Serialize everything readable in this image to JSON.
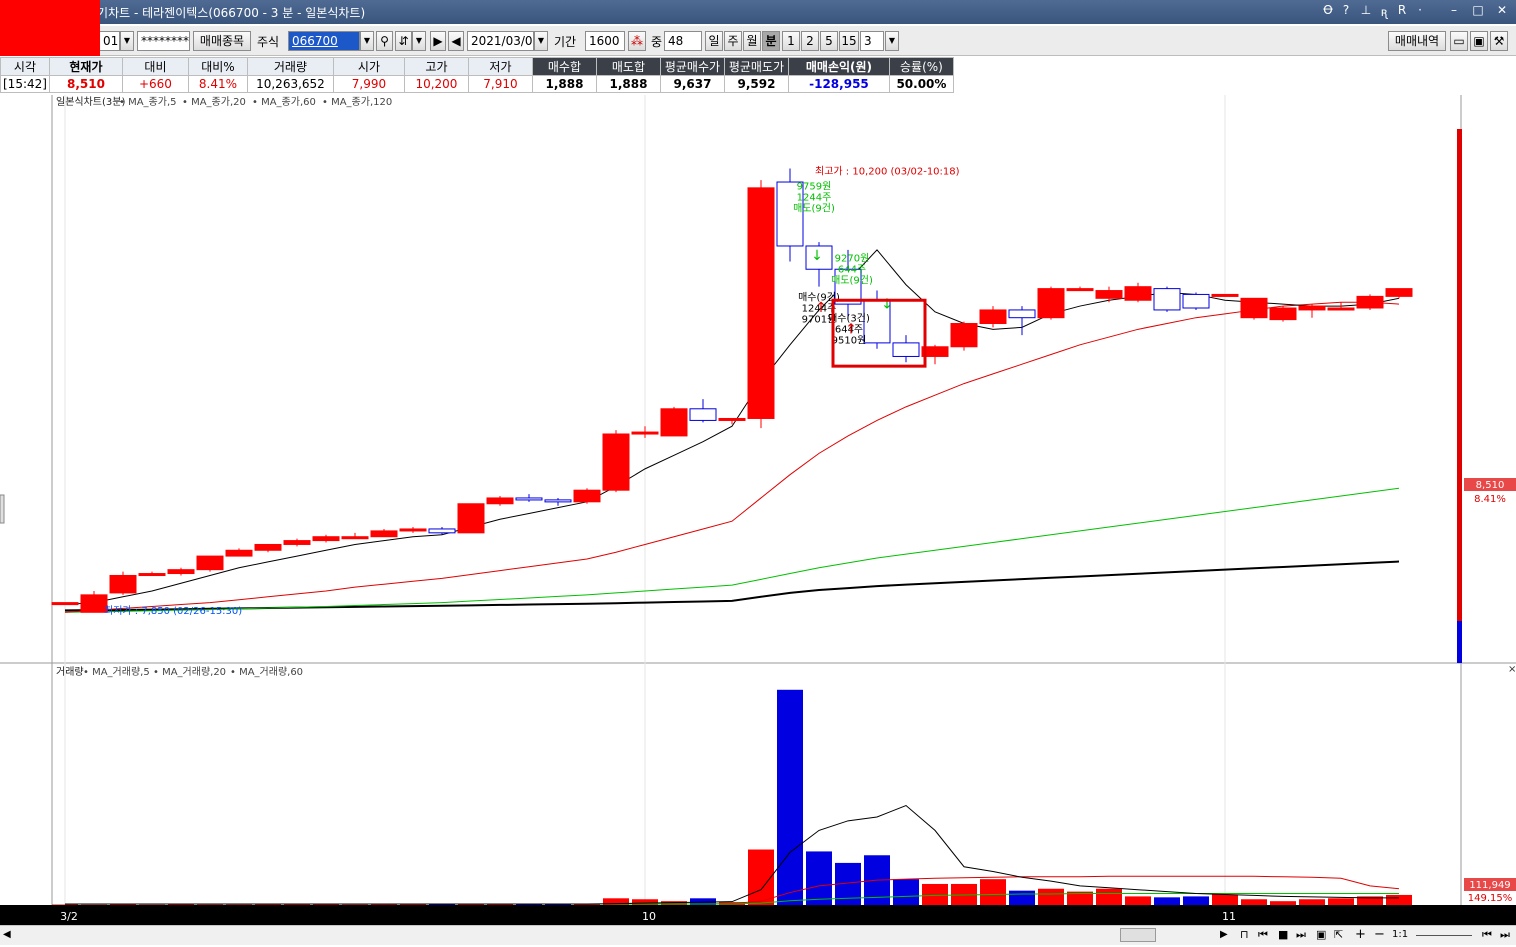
{
  "window": {
    "title": "[2450]매매복기차트 - 테라젠이텍스(066700 - 3 분 - 일본식차트)",
    "controls": [
      "Ꝋ",
      "?",
      "⊥",
      "ꭆ",
      "R",
      "·",
      "–",
      "□",
      "✕"
    ]
  },
  "toolbar": {
    "account_suffix": "01",
    "password": "********",
    "trade_items_button": "매매종목",
    "market_type": "주식",
    "stock_code": "066700",
    "date": "2021/03/02",
    "period_label": "기간",
    "period_value": "1600",
    "mid_label": "중",
    "count_value": "48",
    "period_buttons": [
      "일",
      "주",
      "월",
      "분"
    ],
    "selected_period": "분",
    "minute_buttons": [
      "1",
      "2",
      "5",
      "15"
    ],
    "minute_value": "3",
    "trade_history_button": "매매내역"
  },
  "info": {
    "headers": [
      "시각",
      "현재가",
      "대비",
      "대비%",
      "거래량",
      "시가",
      "고가",
      "저가",
      "매수합",
      "매도합",
      "평균매수가",
      "평균매도가",
      "매매손익(원)",
      "승률(%)"
    ],
    "values": [
      "[15:42]",
      "8,510",
      "+660",
      "8.41%",
      "10,263,652",
      "7,990",
      "10,200",
      "7,910",
      "1,888",
      "1,888",
      "9,637",
      "9,592",
      "-128,955",
      "50.00%"
    ]
  },
  "chart_data": [
    {
      "type": "candlestick",
      "title": "일본식차트(3분)",
      "legend": [
        {
          "name": "MA_종가,5",
          "color": "#e00000"
        },
        {
          "name": "MA_종가,20",
          "color": "#000000"
        },
        {
          "name": "MA_종가,60",
          "color": "#e00000"
        },
        {
          "name": "MA_종가,120",
          "color": "#00c000"
        }
      ],
      "ylim": [
        7700,
        10450
      ],
      "x_ticks": [
        {
          "index": 0,
          "label": "3/2"
        },
        {
          "index": 20,
          "label": "10"
        },
        {
          "index": 40,
          "label": "11"
        }
      ],
      "candles": [
        {
          "o": 7960,
          "c": 7960,
          "h": 7960,
          "l": 7960
        },
        {
          "o": 7910,
          "c": 8000,
          "h": 8020,
          "l": 7910
        },
        {
          "o": 8010,
          "c": 8100,
          "h": 8120,
          "l": 8000
        },
        {
          "o": 8100,
          "c": 8110,
          "h": 8120,
          "l": 8100
        },
        {
          "o": 8110,
          "c": 8130,
          "h": 8140,
          "l": 8100
        },
        {
          "o": 8130,
          "c": 8200,
          "h": 8200,
          "l": 8120
        },
        {
          "o": 8200,
          "c": 8230,
          "h": 8240,
          "l": 8200
        },
        {
          "o": 8230,
          "c": 8260,
          "h": 8260,
          "l": 8220
        },
        {
          "o": 8260,
          "c": 8280,
          "h": 8290,
          "l": 8250
        },
        {
          "o": 8280,
          "c": 8300,
          "h": 8310,
          "l": 8270
        },
        {
          "o": 8300,
          "c": 8300,
          "h": 8320,
          "l": 8290
        },
        {
          "o": 8300,
          "c": 8330,
          "h": 8340,
          "l": 8300
        },
        {
          "o": 8330,
          "c": 8340,
          "h": 8350,
          "l": 8320
        },
        {
          "o": 8340,
          "c": 8320,
          "h": 8350,
          "l": 8310
        },
        {
          "o": 8320,
          "c": 8470,
          "h": 8470,
          "l": 8320
        },
        {
          "o": 8470,
          "c": 8500,
          "h": 8510,
          "l": 8460
        },
        {
          "o": 8500,
          "c": 8490,
          "h": 8520,
          "l": 8480
        },
        {
          "o": 8490,
          "c": 8480,
          "h": 8500,
          "l": 8460
        },
        {
          "o": 8480,
          "c": 8540,
          "h": 8550,
          "l": 8470
        },
        {
          "o": 8540,
          "c": 8830,
          "h": 8850,
          "l": 8530
        },
        {
          "o": 8830,
          "c": 8840,
          "h": 8870,
          "l": 8810
        },
        {
          "o": 8820,
          "c": 8960,
          "h": 8970,
          "l": 8820
        },
        {
          "o": 8960,
          "c": 8900,
          "h": 9010,
          "l": 8890
        },
        {
          "o": 8900,
          "c": 8910,
          "h": 8910,
          "l": 8880
        },
        {
          "o": 8910,
          "c": 10100,
          "h": 10140,
          "l": 8860
        },
        {
          "o": 10130,
          "c": 9800,
          "h": 10200,
          "l": 9720
        },
        {
          "o": 9800,
          "c": 9680,
          "h": 9820,
          "l": 9590
        },
        {
          "o": 9680,
          "c": 9500,
          "h": 9780,
          "l": 9420
        },
        {
          "o": 9520,
          "c": 9300,
          "h": 9570,
          "l": 9270
        },
        {
          "o": 9300,
          "c": 9230,
          "h": 9340,
          "l": 9200
        },
        {
          "o": 9230,
          "c": 9280,
          "h": 9290,
          "l": 9190
        },
        {
          "o": 9280,
          "c": 9400,
          "h": 9410,
          "l": 9260
        },
        {
          "o": 9400,
          "c": 9470,
          "h": 9490,
          "l": 9380
        },
        {
          "o": 9470,
          "c": 9430,
          "h": 9490,
          "l": 9340
        },
        {
          "o": 9430,
          "c": 9580,
          "h": 9590,
          "l": 9420
        },
        {
          "o": 9580,
          "c": 9580,
          "h": 9590,
          "l": 9570
        },
        {
          "o": 9530,
          "c": 9570,
          "h": 9590,
          "l": 9510
        },
        {
          "o": 9520,
          "c": 9590,
          "h": 9610,
          "l": 9510
        },
        {
          "o": 9580,
          "c": 9470,
          "h": 9590,
          "l": 9460
        },
        {
          "o": 9550,
          "c": 9480,
          "h": 9560,
          "l": 9470
        },
        {
          "o": 9540,
          "c": 9550,
          "h": 9550,
          "l": 9540
        },
        {
          "o": 9430,
          "c": 9530,
          "h": 9530,
          "l": 9420
        },
        {
          "o": 9420,
          "c": 9480,
          "h": 9490,
          "l": 9410
        },
        {
          "o": 9470,
          "c": 9490,
          "h": 9500,
          "l": 9430
        },
        {
          "o": 9480,
          "c": 9480,
          "h": 9510,
          "l": 9470
        },
        {
          "o": 9480,
          "c": 9540,
          "h": 9550,
          "l": 9470
        },
        {
          "o": 9540,
          "c": 9580,
          "h": 9580,
          "l": 9530
        }
      ],
      "ma5": [
        7950,
        7960,
        7990,
        8020,
        8060,
        8100,
        8140,
        8170,
        8200,
        8230,
        8260,
        8280,
        8300,
        8310,
        8350,
        8390,
        8420,
        8450,
        8480,
        8560,
        8650,
        8720,
        8790,
        8870,
        9100,
        9290,
        9470,
        9620,
        9780,
        9600,
        9460,
        9400,
        9370,
        9380,
        9450,
        9490,
        9520,
        9540,
        9560,
        9550,
        9520,
        9510,
        9500,
        9490,
        9490,
        9500,
        9530
      ],
      "ma20": [
        7910,
        7920,
        7930,
        7940,
        7950,
        7960,
        7975,
        7990,
        8005,
        8020,
        8040,
        8055,
        8070,
        8085,
        8105,
        8125,
        8145,
        8165,
        8185,
        8220,
        8260,
        8300,
        8340,
        8380,
        8500,
        8620,
        8730,
        8820,
        8900,
        8970,
        9030,
        9090,
        9140,
        9190,
        9240,
        9290,
        9330,
        9370,
        9400,
        9430,
        9450,
        9470,
        9490,
        9500,
        9510,
        9510,
        9500
      ],
      "ma60": [
        7910,
        7912,
        7915,
        7918,
        7921,
        7924,
        7928,
        7932,
        7936,
        7940,
        7945,
        7950,
        7955,
        7960,
        7968,
        7976,
        7984,
        7992,
        8000,
        8010,
        8020,
        8030,
        8040,
        8050,
        8080,
        8110,
        8140,
        8165,
        8190,
        8210,
        8230,
        8250,
        8270,
        8290,
        8310,
        8330,
        8350,
        8370,
        8390,
        8410,
        8430,
        8450,
        8470,
        8490,
        8510,
        8530,
        8550
      ],
      "ma120": [
        7920,
        7921,
        7922,
        7924,
        7926,
        7928,
        7930,
        7932,
        7934,
        7936,
        7938,
        7940,
        7942,
        7944,
        7946,
        7948,
        7950,
        7952,
        7954,
        7957,
        7960,
        7963,
        7966,
        7969,
        7990,
        8010,
        8025,
        8035,
        8045,
        8053,
        8060,
        8067,
        8074,
        8081,
        8088,
        8095,
        8102,
        8109,
        8116,
        8123,
        8130,
        8137,
        8144,
        8151,
        8158,
        8165,
        8172
      ],
      "annotations": {
        "high": "최고가 : 10,200 (03/02-10:18)",
        "low": "최저가 : 7,850 (02/26-15:30)",
        "sell1": [
          "9759원",
          "1244주",
          "매도(9건)"
        ],
        "sell2": [
          "9270원",
          "644주",
          "매도(9건)"
        ],
        "buy1": [
          "매수(9건)",
          "1244주",
          "9701원"
        ],
        "buy2": [
          "매수(3건)",
          "644주",
          "9510원"
        ]
      },
      "price_label": "8,510",
      "change_label": "8.41%"
    },
    {
      "type": "bar",
      "title": "거래량",
      "legend": [
        {
          "name": "MA_거래량,5",
          "color": "#e00000"
        },
        {
          "name": "MA_거래량,20",
          "color": "#000000"
        },
        {
          "name": "MA_거래량,60",
          "color": "#e00000"
        }
      ],
      "ylim": [
        0,
        230000
      ],
      "volumes": [
        500,
        300,
        600,
        300,
        800,
        400,
        400,
        500,
        500,
        600,
        400,
        500,
        500,
        600,
        1200,
        900,
        1000,
        1200,
        1500,
        7000,
        6000,
        4000,
        7000,
        3000,
        58000,
        225000,
        56000,
        44000,
        52000,
        27000,
        22000,
        22000,
        27000,
        15000,
        17000,
        14000,
        17000,
        9000,
        8000,
        9000,
        11000,
        6000,
        4000,
        6000,
        7000,
        9000,
        10500
      ],
      "vol_ma5": [
        1000,
        1000,
        1000,
        1000,
        1000,
        1000,
        1000,
        1000,
        1000,
        1000,
        1000,
        1000,
        1000,
        1000,
        1000,
        1000,
        1000,
        1000,
        1000,
        1500,
        2000,
        2500,
        3000,
        3500,
        16000,
        55000,
        78000,
        88000,
        92000,
        104000,
        78000,
        40000,
        35000,
        29000,
        25000,
        20000,
        18000,
        16000,
        14000,
        12000,
        11000,
        10000,
        9000,
        8500,
        8000,
        7500,
        7500
      ],
      "vol_ma20": [
        1000,
        1000,
        1000,
        1000,
        1000,
        1000,
        1000,
        1000,
        1000,
        1000,
        1000,
        1000,
        1000,
        1000,
        1000,
        1000,
        1000,
        1000,
        1000,
        1000,
        1000,
        1000,
        1000,
        1500,
        4000,
        13000,
        20000,
        23000,
        26000,
        27000,
        28000,
        28500,
        29000,
        29500,
        29500,
        29500,
        30000,
        30000,
        30000,
        30000,
        30000,
        30000,
        29500,
        29000,
        28000,
        20000,
        17000
      ],
      "vol_ma60": [
        1000,
        1000,
        1000,
        1000,
        1000,
        1000,
        1000,
        1000,
        1000,
        1000,
        1000,
        1000,
        1000,
        1000,
        1000,
        1000,
        1000,
        1000,
        1000,
        1000,
        1000,
        1000,
        1000,
        1000,
        2000,
        4500,
        6000,
        7000,
        8000,
        9000,
        10000,
        10500,
        11000,
        11500,
        11500,
        12000,
        12000,
        12000,
        12000,
        12000,
        12000,
        12000,
        12000,
        12000,
        12000,
        12000,
        12000
      ],
      "volume_label": "111,949",
      "volume_pct_label": "149.15%"
    }
  ],
  "scrollbar": {
    "controls": [
      "⊓",
      "⏮",
      "■",
      "⏭",
      "▣",
      "⇱",
      "+",
      "−",
      "1:1",
      "⏮",
      "⏭"
    ]
  }
}
